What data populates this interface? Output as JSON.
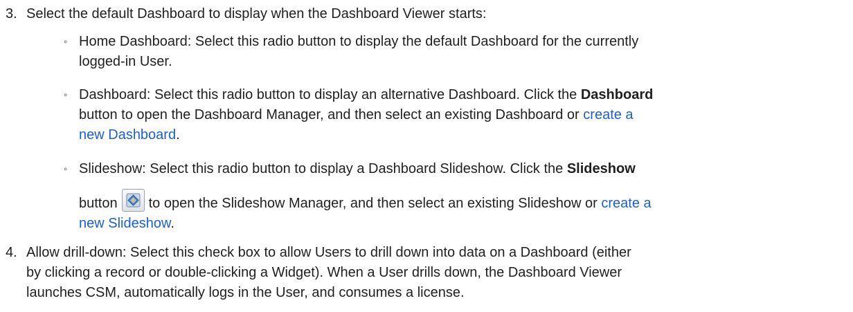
{
  "step3": {
    "number": "3.",
    "text": "Select the default Dashboard to display when the Dashboard Viewer starts:",
    "bullet_mark": "◦",
    "options": [
      {
        "line1": "Home Dashboard: Select this radio button to display the default Dashboard for the currently",
        "line2": "logged-in User."
      },
      {
        "line1_pre": "Dashboard: Select this radio button to display an alternative Dashboard. Click the ",
        "line1_bold": "Dashboard",
        "line2_pre": "button to open the Dashboard Manager, and then select an existing Dashboard or ",
        "line2_link": "create a",
        "line3_link": "new Dashboard",
        "line3_post": "."
      },
      {
        "line1_pre": "Slideshow: Select this radio button to display a Dashboard Slideshow. Click the ",
        "line1_bold": "Slideshow",
        "line2_pre": "button",
        "line2_mid": "to open the Slideshow Manager, and then select an existing Slideshow or ",
        "line2_link": "create a",
        "line3_link": "new Slideshow",
        "line3_post": "."
      }
    ]
  },
  "step4": {
    "number": "4.",
    "line1": "Allow drill-down: Select this check box to allow Users to drill down into data on a Dashboard (either",
    "line2": "by clicking a record or double-clicking a Widget). When a User drills down, the Dashboard Viewer",
    "line3": "launches CSM, automatically logs in the User, and consumes a license."
  },
  "icons": {
    "slideshow_button": "slideshow-icon"
  }
}
